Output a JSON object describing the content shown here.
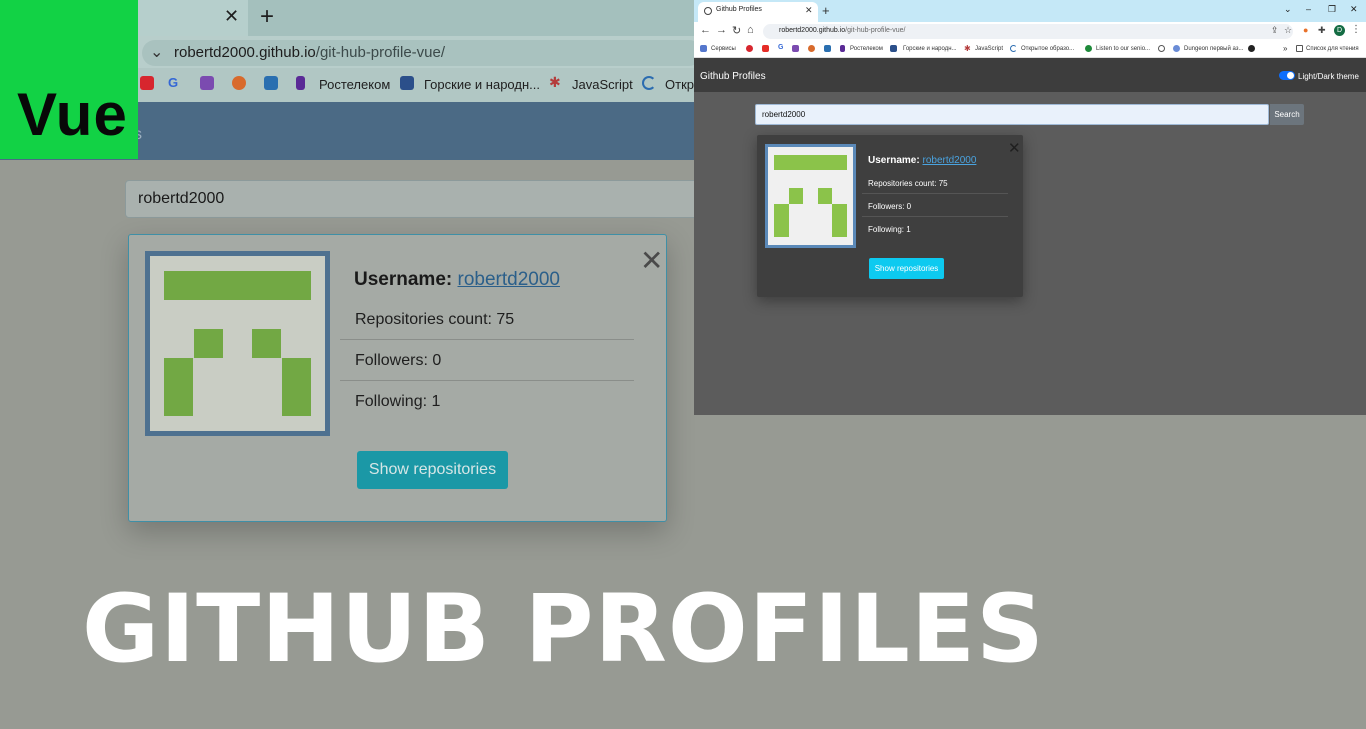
{
  "background_browser": {
    "url_host": "robertd2000.github.io",
    "url_path": "/git-hub-profile-vue/",
    "bookmarks": [
      "Ростелеком",
      "Горские и народн...",
      "JavaScript",
      "Откр"
    ],
    "navbar_fragment": "s",
    "search_value": "robertd2000",
    "card": {
      "username_label": "Username:",
      "username": "robertd2000",
      "repos": "Repositories count: 75",
      "followers": "Followers: 0",
      "following": "Following: 1",
      "button": "Show repositories"
    }
  },
  "badge": {
    "text": "Vue",
    "color": "#12d245"
  },
  "title": "GITHUB PROFILES",
  "foreground_browser": {
    "tab_title": "Github Profiles",
    "url_host": "robertd2000.github.io",
    "url_path": "/git-hub-profile-vue/",
    "profile_initial": "D",
    "bookmarks": [
      "Сервисы",
      "Ростелеком",
      "Горские и народн...",
      "JavaScript",
      "Открытое образо...",
      "Listen to our senio...",
      "Dungeon первый аз...",
      "Список для чтения"
    ],
    "brand": "Github Profiles",
    "theme_toggle_label": "Light/Dark theme",
    "search_value": "robertd2000",
    "search_button": "Search",
    "card": {
      "username_label": "Username:",
      "username": "robertd2000",
      "repos": "Repositories count: 75",
      "followers": "Followers: 0",
      "following": "Following: 1",
      "button": "Show repositories"
    }
  },
  "icons": [
    "close-icon",
    "plus-icon",
    "chevron-down-icon",
    "back-icon",
    "forward-icon",
    "reload-icon",
    "home-icon",
    "star-icon",
    "extensions-icon",
    "github-icon"
  ],
  "colors": {
    "identicon_green": "#72a844",
    "button_teal": "#1b98a6",
    "button_cyan": "#0dcaf0",
    "link_blue": "#4aa3df",
    "toggle_blue": "#0d6efd"
  }
}
